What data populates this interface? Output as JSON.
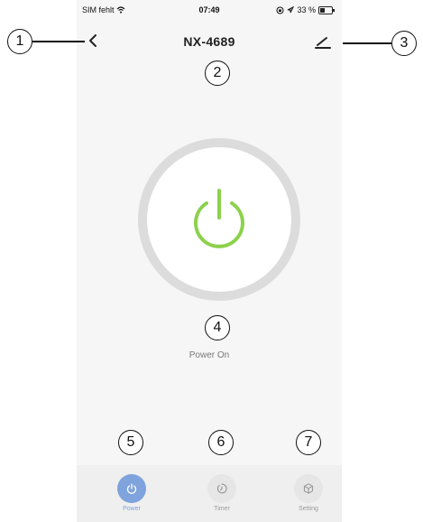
{
  "status_bar": {
    "carrier": "SIM fehlt",
    "time": "07:49",
    "battery": "33 %",
    "icons": [
      "wifi-icon",
      "lock-rotation-icon",
      "location-icon",
      "battery-icon"
    ]
  },
  "nav": {
    "back_icon": "chevron-left-icon",
    "title": "NX-4689",
    "edit_icon": "edit-icon"
  },
  "power": {
    "state_label": "Power On",
    "icon": "power-icon",
    "icon_color": "#8cd14b"
  },
  "tabs": [
    {
      "label": "Power",
      "icon": "power-icon",
      "active": true
    },
    {
      "label": "Timer",
      "icon": "timer-icon",
      "active": false
    },
    {
      "label": "Setting",
      "icon": "settings-cube-icon",
      "active": false
    }
  ],
  "annotations": {
    "n1": "1",
    "n2": "2",
    "n3": "3",
    "n4": "4",
    "n5": "5",
    "n6": "6",
    "n7": "7"
  },
  "colors": {
    "accent": "#7ea3dd",
    "power_green": "#8cd14b"
  }
}
